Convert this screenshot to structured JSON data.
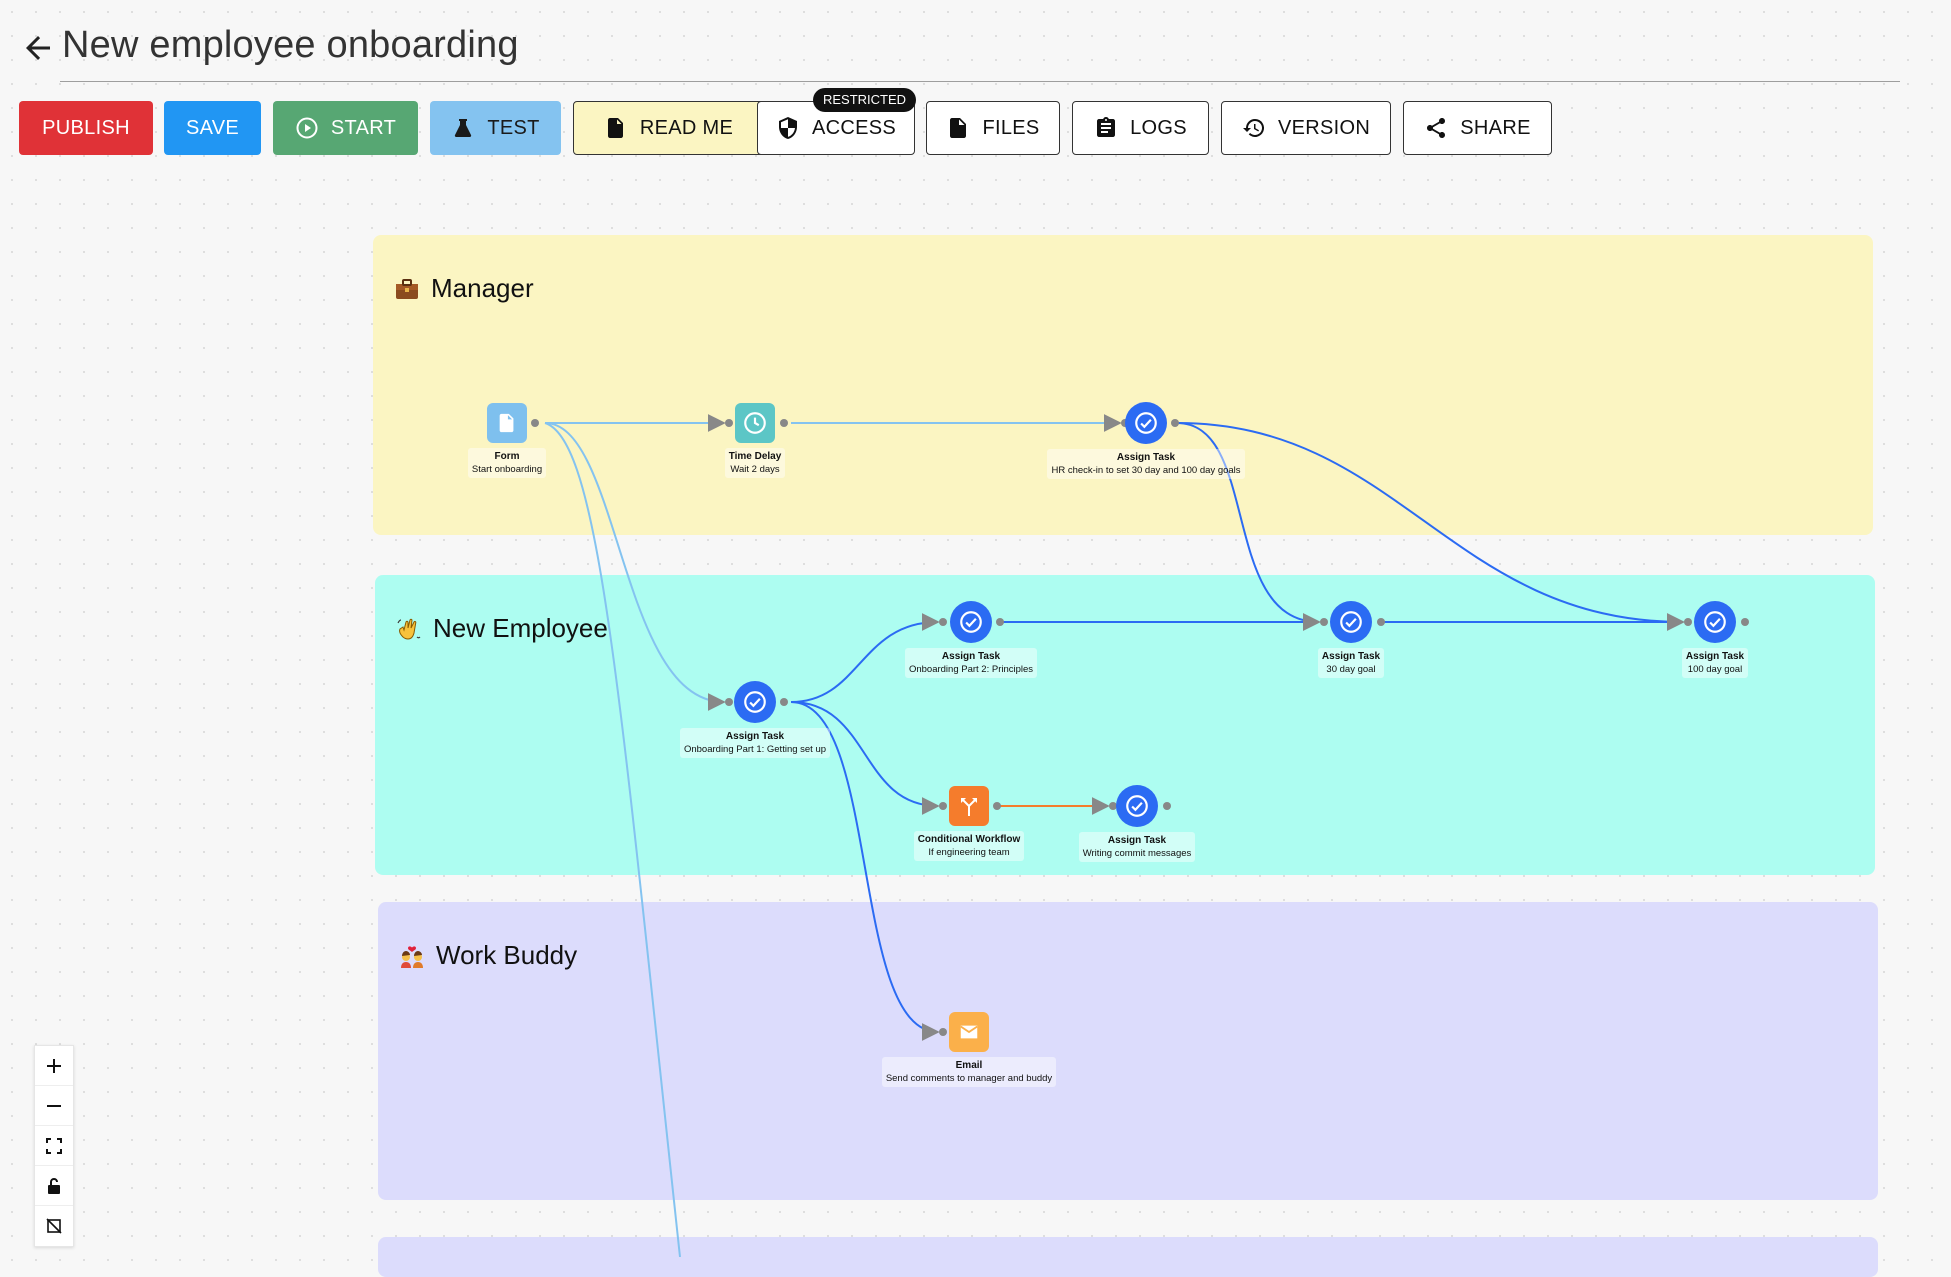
{
  "header": {
    "title": "New employee onboarding"
  },
  "toolbar": {
    "publish": "PUBLISH",
    "save": "SAVE",
    "start": "START",
    "test": "TEST",
    "readme": "READ ME",
    "access": "ACCESS",
    "access_badge": "RESTRICTED",
    "files": "FILES",
    "logs": "LOGS",
    "version": "VERSION",
    "share": "SHARE"
  },
  "lanes": [
    {
      "name": "Manager",
      "emoji": "briefcase-icon",
      "color": "#fbf5c2"
    },
    {
      "name": "New Employee",
      "emoji": "waving-hand-icon",
      "color": "#adfdf1"
    },
    {
      "name": "Work Buddy",
      "emoji": "couple-with-heart-icon",
      "color": "#dcdcfc"
    }
  ],
  "nodes": {
    "form": {
      "title": "Form",
      "subtitle": "Start onboarding",
      "icon": "document-icon",
      "color": "#7ec0ee"
    },
    "delay": {
      "title": "Time Delay",
      "subtitle": "Wait 2 days",
      "icon": "clock-icon",
      "color": "#5cc6c6"
    },
    "hr_checkin": {
      "title": "Assign Task",
      "subtitle": "HR check-in to set 30 day and 100 day goals",
      "icon": "check-circle-icon",
      "color": "#2b6bf3"
    },
    "part1": {
      "title": "Assign Task",
      "subtitle": "Onboarding Part 1: Getting set up",
      "icon": "check-circle-icon",
      "color": "#2b6bf3"
    },
    "part2": {
      "title": "Assign Task",
      "subtitle": "Onboarding Part 2: Principles",
      "icon": "check-circle-icon",
      "color": "#2b6bf3"
    },
    "goal30": {
      "title": "Assign Task",
      "subtitle": "30 day goal",
      "icon": "check-circle-icon",
      "color": "#2b6bf3"
    },
    "goal100": {
      "title": "Assign Task",
      "subtitle": "100 day goal",
      "icon": "check-circle-icon",
      "color": "#2b6bf3"
    },
    "conditional": {
      "title": "Conditional Workflow",
      "subtitle": "If engineering team",
      "icon": "branch-icon",
      "color": "#f57c2c"
    },
    "commit": {
      "title": "Assign Task",
      "subtitle": "Writing commit messages",
      "icon": "check-circle-icon",
      "color": "#2b6bf3"
    },
    "email": {
      "title": "Email",
      "subtitle": "Send comments to manager and buddy",
      "icon": "envelope-icon",
      "color": "#fbb04a"
    }
  },
  "colors": {
    "edge_light": "#84c3f0",
    "edge_dark": "#2b6bf3",
    "edge_orange": "#f57c2c"
  },
  "zoom_controls": [
    "zoom-in-icon",
    "zoom-out-icon",
    "fit-view-icon",
    "lock-icon",
    "toggle-minimap-icon"
  ]
}
